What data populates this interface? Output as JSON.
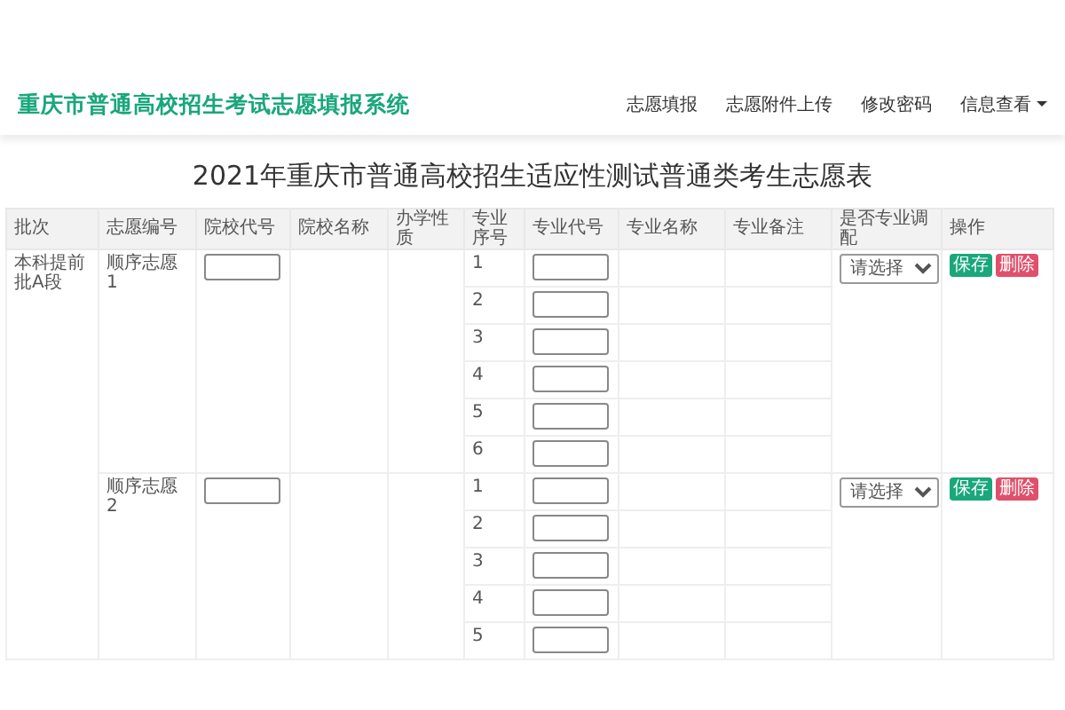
{
  "brand": "重庆市普通高校招生考试志愿填报系统",
  "nav": [
    {
      "label": "志愿填报",
      "dropdown": false
    },
    {
      "label": "志愿附件上传",
      "dropdown": false
    },
    {
      "label": "修改密码",
      "dropdown": false
    },
    {
      "label": "信息查看",
      "dropdown": true
    }
  ],
  "title": "2021年重庆市普通高校招生适应性测试普通类考生志愿表",
  "table": {
    "columns": [
      "批次",
      "志愿编号",
      "院校代号",
      "院校名称",
      "办学性质",
      "专业序号",
      "专业代号",
      "专业名称",
      "专业备注",
      "是否专业调配",
      "操作"
    ],
    "batch": "本科提前批A段",
    "groups": [
      {
        "number": "顺序志愿1",
        "adjust_placeholder": "请选择",
        "save": "保存",
        "delete": "删除",
        "majors": [
          "1",
          "2",
          "3",
          "4",
          "5",
          "6"
        ]
      },
      {
        "number": "顺序志愿2",
        "adjust_placeholder": "请选择",
        "save": "保存",
        "delete": "删除",
        "majors": [
          "1",
          "2",
          "3",
          "4",
          "5"
        ]
      }
    ]
  }
}
